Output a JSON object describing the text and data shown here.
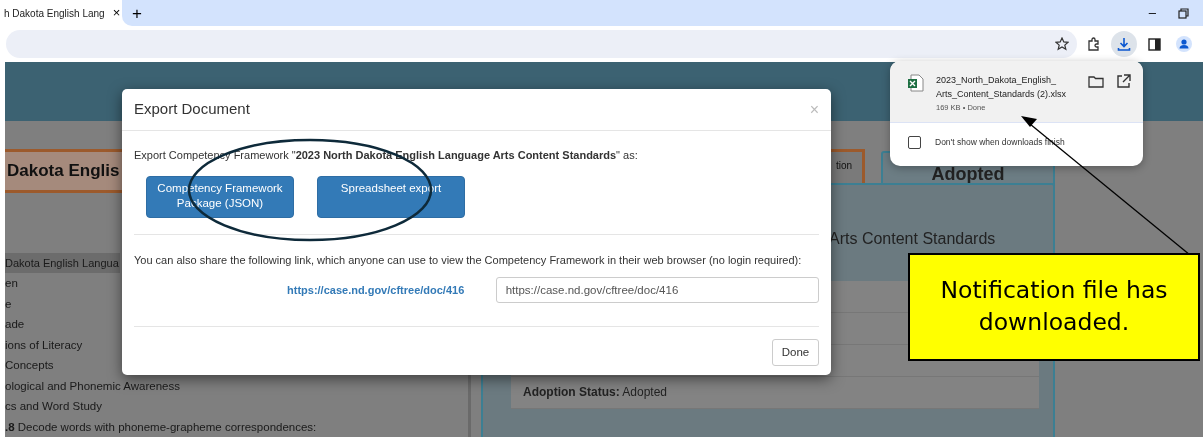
{
  "browser": {
    "tab": {
      "title": "h Dakota English Lang",
      "close": "×"
    },
    "new_tab": "+",
    "window_controls": [
      "–"
    ]
  },
  "page": {
    "title_box": "Dakota Englis",
    "tree": [
      {
        "label": "Dakota English Langua",
        "selected": true
      },
      {
        "label": "en",
        "selected": false
      },
      {
        "label": "e",
        "selected": false
      },
      {
        "label": "ade",
        "selected": false
      },
      {
        "label": "ions of Literacy",
        "selected": false
      },
      {
        "label": "Concepts",
        "selected": false
      },
      {
        "label": "ological and Phonemic Awareness",
        "selected": false
      },
      {
        "label": "cs and Word Study",
        "selected": false
      },
      {
        "label": "**.8** Decode words with phoneme-grapheme correspondences:",
        "selected": false
      }
    ],
    "side_button": "tion",
    "status_box": "Adopted",
    "panel_heading": "Arts Content Standards",
    "adoption_label": "Adoption Status:",
    "adoption_value": "Adopted"
  },
  "dialog": {
    "title": "Export Document",
    "close": "×",
    "intro": "Export Competency Framework \"**2023 North Dakota English Language Arts Content Standards**\" as:",
    "buttons": [
      "Competency Framework Package (JSON)",
      "Spreadsheet export"
    ],
    "share_text": "You can also share the following link, which anyone can use to view the Competency Framework in their web browser (no login required):",
    "link": "https://case.nd.gov/cftree/doc/416",
    "link_field": "https://case.nd.gov/cftree/doc/416",
    "done": "Done"
  },
  "downloads": {
    "file_line1": "2023_North_Dakota_English_",
    "file_line2": "Arts_Content_Standards (2).xlsx",
    "meta": "169 KB • Done",
    "dont_show": {
      "label": "Don't show when downloads finish",
      "checked": false
    }
  },
  "annotation": {
    "callout": "Notification file has downloaded."
  }
}
